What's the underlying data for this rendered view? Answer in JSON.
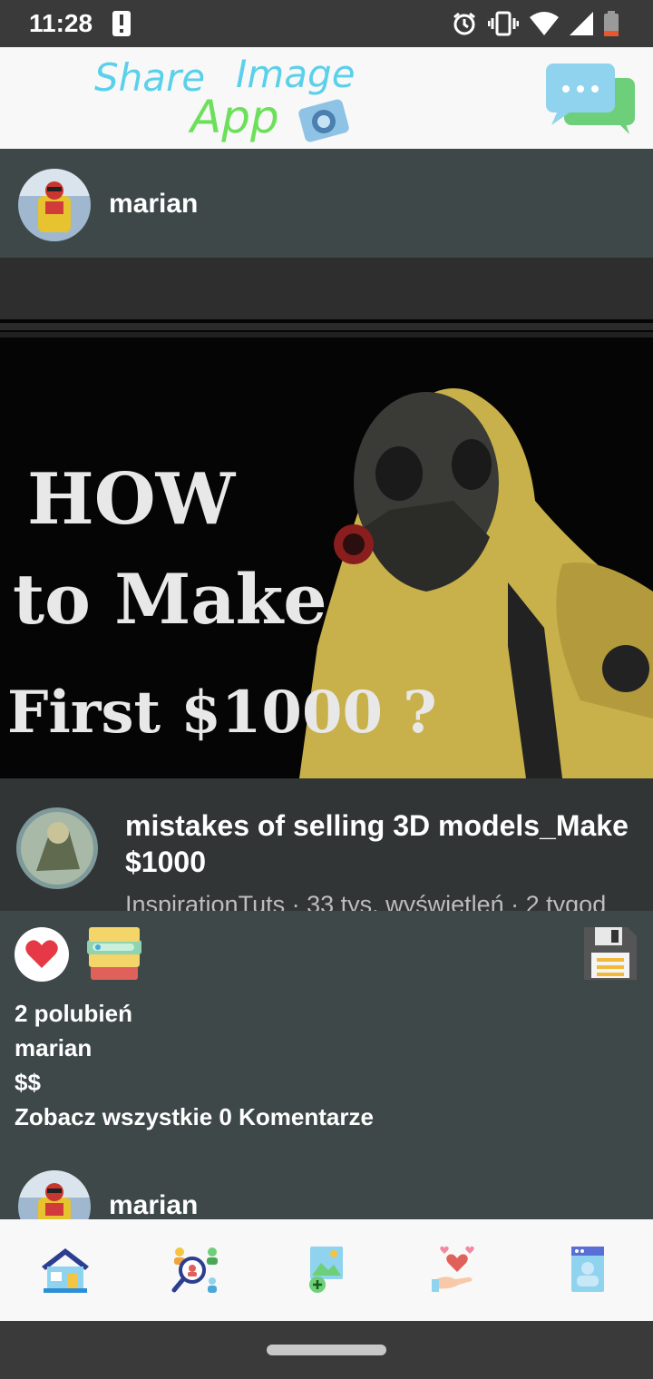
{
  "status_bar": {
    "time": "11:28"
  },
  "app_bar": {
    "logo_text_1": "Share",
    "logo_text_2": "Image",
    "logo_text_3": "App"
  },
  "post": {
    "username": "marian",
    "media_text": {
      "line1": "HOW",
      "line2": "to Make",
      "line3": "First $1000 ?"
    },
    "video": {
      "title": "mistakes of selling 3D models_Make $1000",
      "meta": "InspirationTuts · 33 tys. wyświetleń · 2 tygod"
    },
    "likes": "2 polubień",
    "caption_user": "marian",
    "caption": "$$",
    "view_comments": "Zobacz wszystkie 0 Komentarze"
  },
  "next_post": {
    "username": "marian"
  },
  "colors": {
    "background": "#3f4849",
    "bars": "#f8f8f8",
    "status": "#3a3a3a",
    "like": "#e53945"
  },
  "bottom_nav": [
    "home-icon",
    "search-people-icon",
    "add-image-icon",
    "donate-heart-icon",
    "profile-icon"
  ]
}
